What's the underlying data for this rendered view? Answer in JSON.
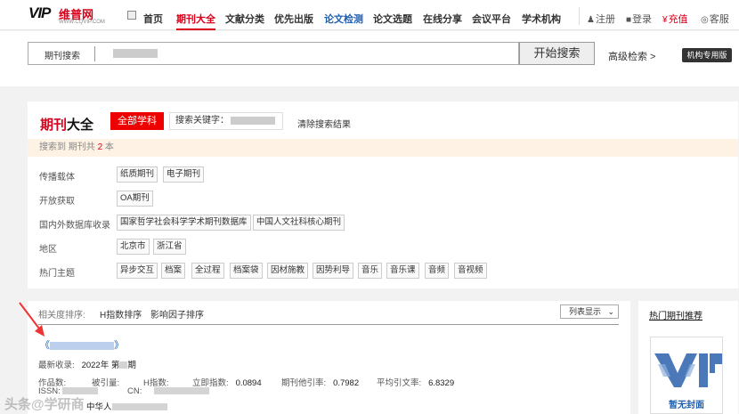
{
  "header": {
    "logo_brand": "VIP",
    "logo_cn": "维普网",
    "logo_url": "WWW.CQVIP.COM",
    "nav": [
      "首页",
      "期刊大全",
      "文献分类",
      "优先出版",
      "论文检测",
      "论文选题",
      "在线分享",
      "会议平台",
      "学术机构"
    ],
    "nav_active": "期刊大全",
    "user_actions": [
      "注册",
      "登录",
      "充值",
      "客服"
    ]
  },
  "search": {
    "label": "期刊搜索",
    "button": "开始搜索",
    "advanced": "高级检索 >",
    "institution": "机构专用版"
  },
  "panel": {
    "title_red": "期刊",
    "title_black": "大全",
    "all_subjects": "全部学科",
    "keyword_label": "搜索关键字：",
    "clear": "清除搜索结果",
    "result_prefix": "搜索到  期刊共",
    "result_count": "2",
    "result_suffix": "本",
    "filters": [
      {
        "label": "传播载体",
        "tags": [
          "纸质期刊",
          "电子期刊"
        ]
      },
      {
        "label": "开放获取",
        "tags": [
          "OA期刊"
        ]
      },
      {
        "label": "国内外数据库收录",
        "tags": [
          "国家哲学社会科学学术期刊数据库",
          "中国人文社科核心期刊"
        ]
      },
      {
        "label": "地区",
        "tags": [
          "北京市",
          "浙江省"
        ]
      },
      {
        "label": "热门主题",
        "tags": [
          "异步交互",
          "档案",
          "全过程",
          "档案袋",
          "因材施教",
          "因势利导",
          "音乐",
          "音乐课",
          "音频",
          "音视频"
        ]
      }
    ]
  },
  "results": {
    "sort_label": "相关度排序:",
    "sort_options": [
      "H指数排序",
      "影响因子排序"
    ],
    "view_mode": "列表显示",
    "item": {
      "title_open": "《",
      "title_close": "》",
      "latest_label": "最新收录:",
      "latest_value": "2022年 第",
      "latest_suffix": "期",
      "works_label": "作品数:",
      "cited_label": "被引量:",
      "h_label": "H指数:",
      "immediacy_label": "立即指数:",
      "immediacy_value": "0.0894",
      "other_cite_label": "期刊他引率:",
      "other_cite_value": "0.7982",
      "avg_cite_label": "平均引文率:",
      "avg_cite_value": "6.8329",
      "issn_label": "ISSN:",
      "cn_label": "CN:",
      "sponsor_partial": "中华人"
    }
  },
  "sidebar": {
    "title": "热门期刊推荐",
    "cover_text": "暂无封面"
  },
  "watermark": "头条@学研商"
}
